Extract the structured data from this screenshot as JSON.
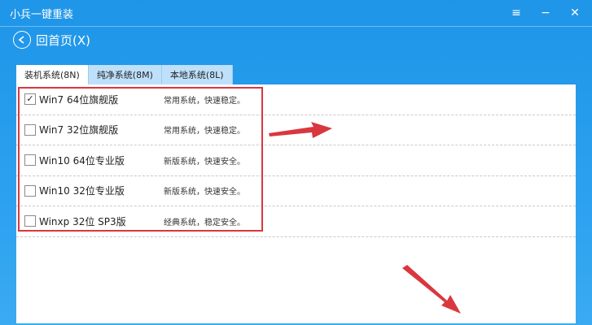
{
  "window": {
    "title": "小兵一键重装",
    "controls": {
      "menu": "≡",
      "minimize": "−",
      "close": "✕"
    }
  },
  "nav": {
    "back_label": "回首页(X)"
  },
  "tabs": [
    {
      "label": "装机系统(8N)",
      "active": true
    },
    {
      "label": "纯净系统(8M)",
      "active": false
    },
    {
      "label": "本地系统(8L)",
      "active": false
    }
  ],
  "options": [
    {
      "name": "Win7 64位旗舰版",
      "desc": "常用系统，快速稳定。",
      "checked": true
    },
    {
      "name": "Win7 32位旗舰版",
      "desc": "常用系统，快速稳定。",
      "checked": false
    },
    {
      "name": "Win10 64位专业版",
      "desc": "新版系统，快速安全。",
      "checked": false
    },
    {
      "name": "Win10 32位专业版",
      "desc": "新版系统，快速安全。",
      "checked": false
    },
    {
      "name": "Winxp 32位 SP3版",
      "desc": "经典系统，稳定安全。",
      "checked": false
    }
  ],
  "checkmark": "✓",
  "colors": {
    "accent": "#1f95e8",
    "highlight": "#d9373f"
  }
}
